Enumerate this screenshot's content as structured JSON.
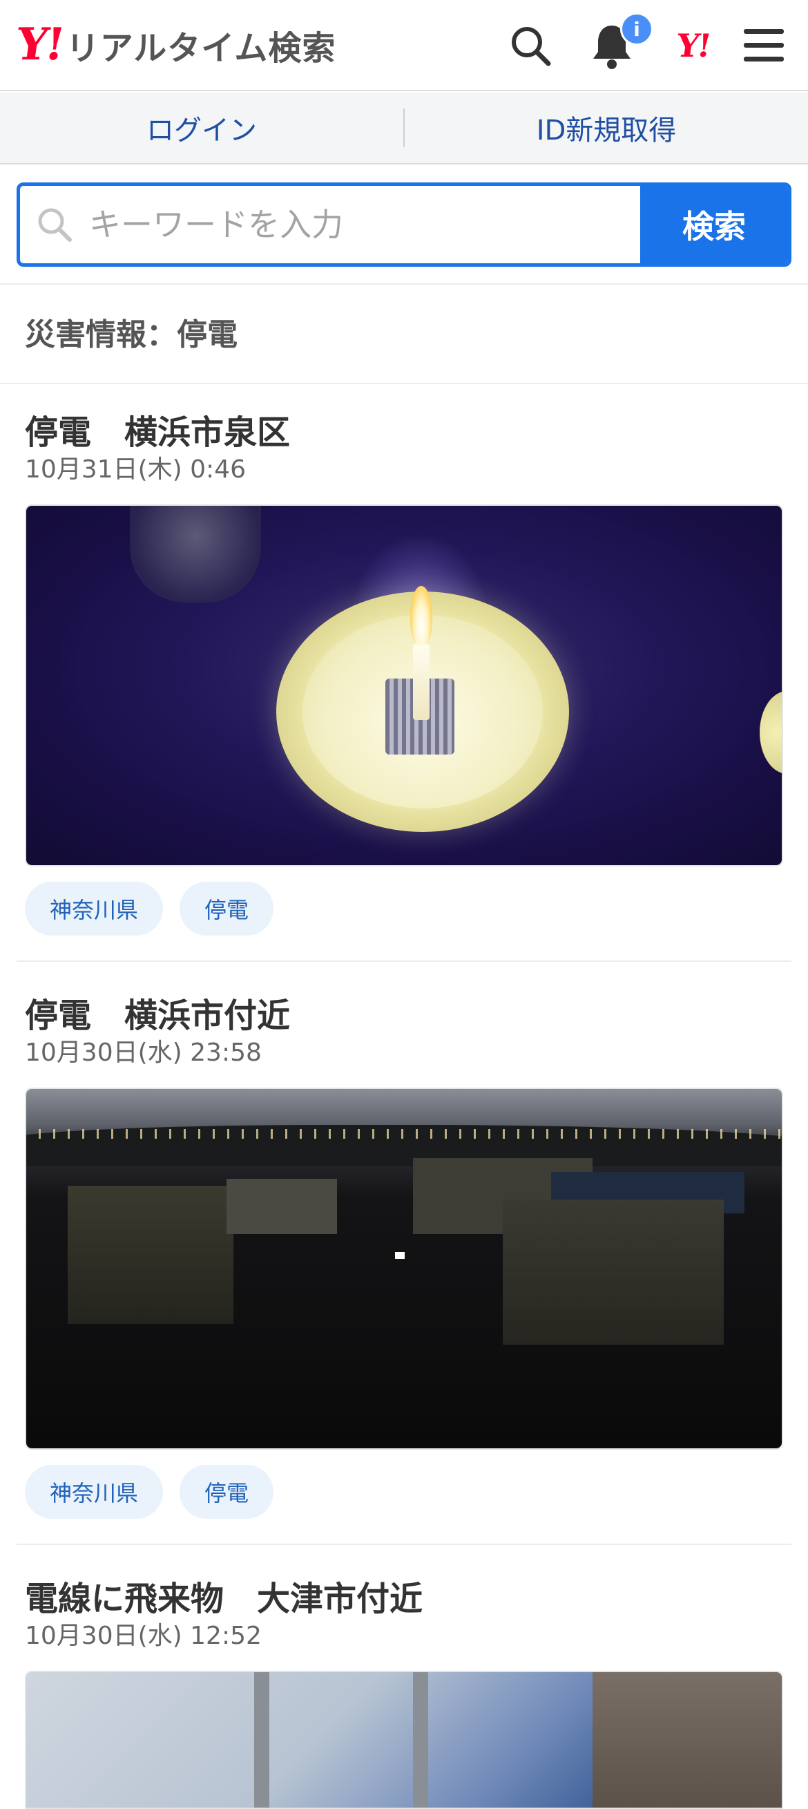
{
  "header": {
    "logo_mark": "Y!",
    "service_name": "リアルタイム検索",
    "notification_badge": "i",
    "yahoo_mark": "Y!"
  },
  "account": {
    "login": "ログイン",
    "signup": "ID新規取得"
  },
  "search": {
    "placeholder": "キーワードを入力",
    "button": "検索"
  },
  "section": {
    "title": "災害情報：停電"
  },
  "articles": [
    {
      "title": "停電　横浜市泉区",
      "date": "10月31日(木) 0:46",
      "tags": [
        "神奈川県",
        "停電"
      ]
    },
    {
      "title": "停電　横浜市付近",
      "date": "10月30日(水) 23:58",
      "tags": [
        "神奈川県",
        "停電"
      ]
    },
    {
      "title": "電線に飛来物　大津市付近",
      "date": "10月30日(水) 12:52",
      "tags": []
    }
  ],
  "colors": {
    "brand_red": "#ff0033",
    "accent_blue": "#1a73e8",
    "link_blue": "#1f4fa3",
    "tag_bg": "#eaf2fc"
  },
  "icons": [
    "search-icon",
    "bell-icon",
    "yahoo-japan-icon",
    "hamburger-menu-icon"
  ]
}
